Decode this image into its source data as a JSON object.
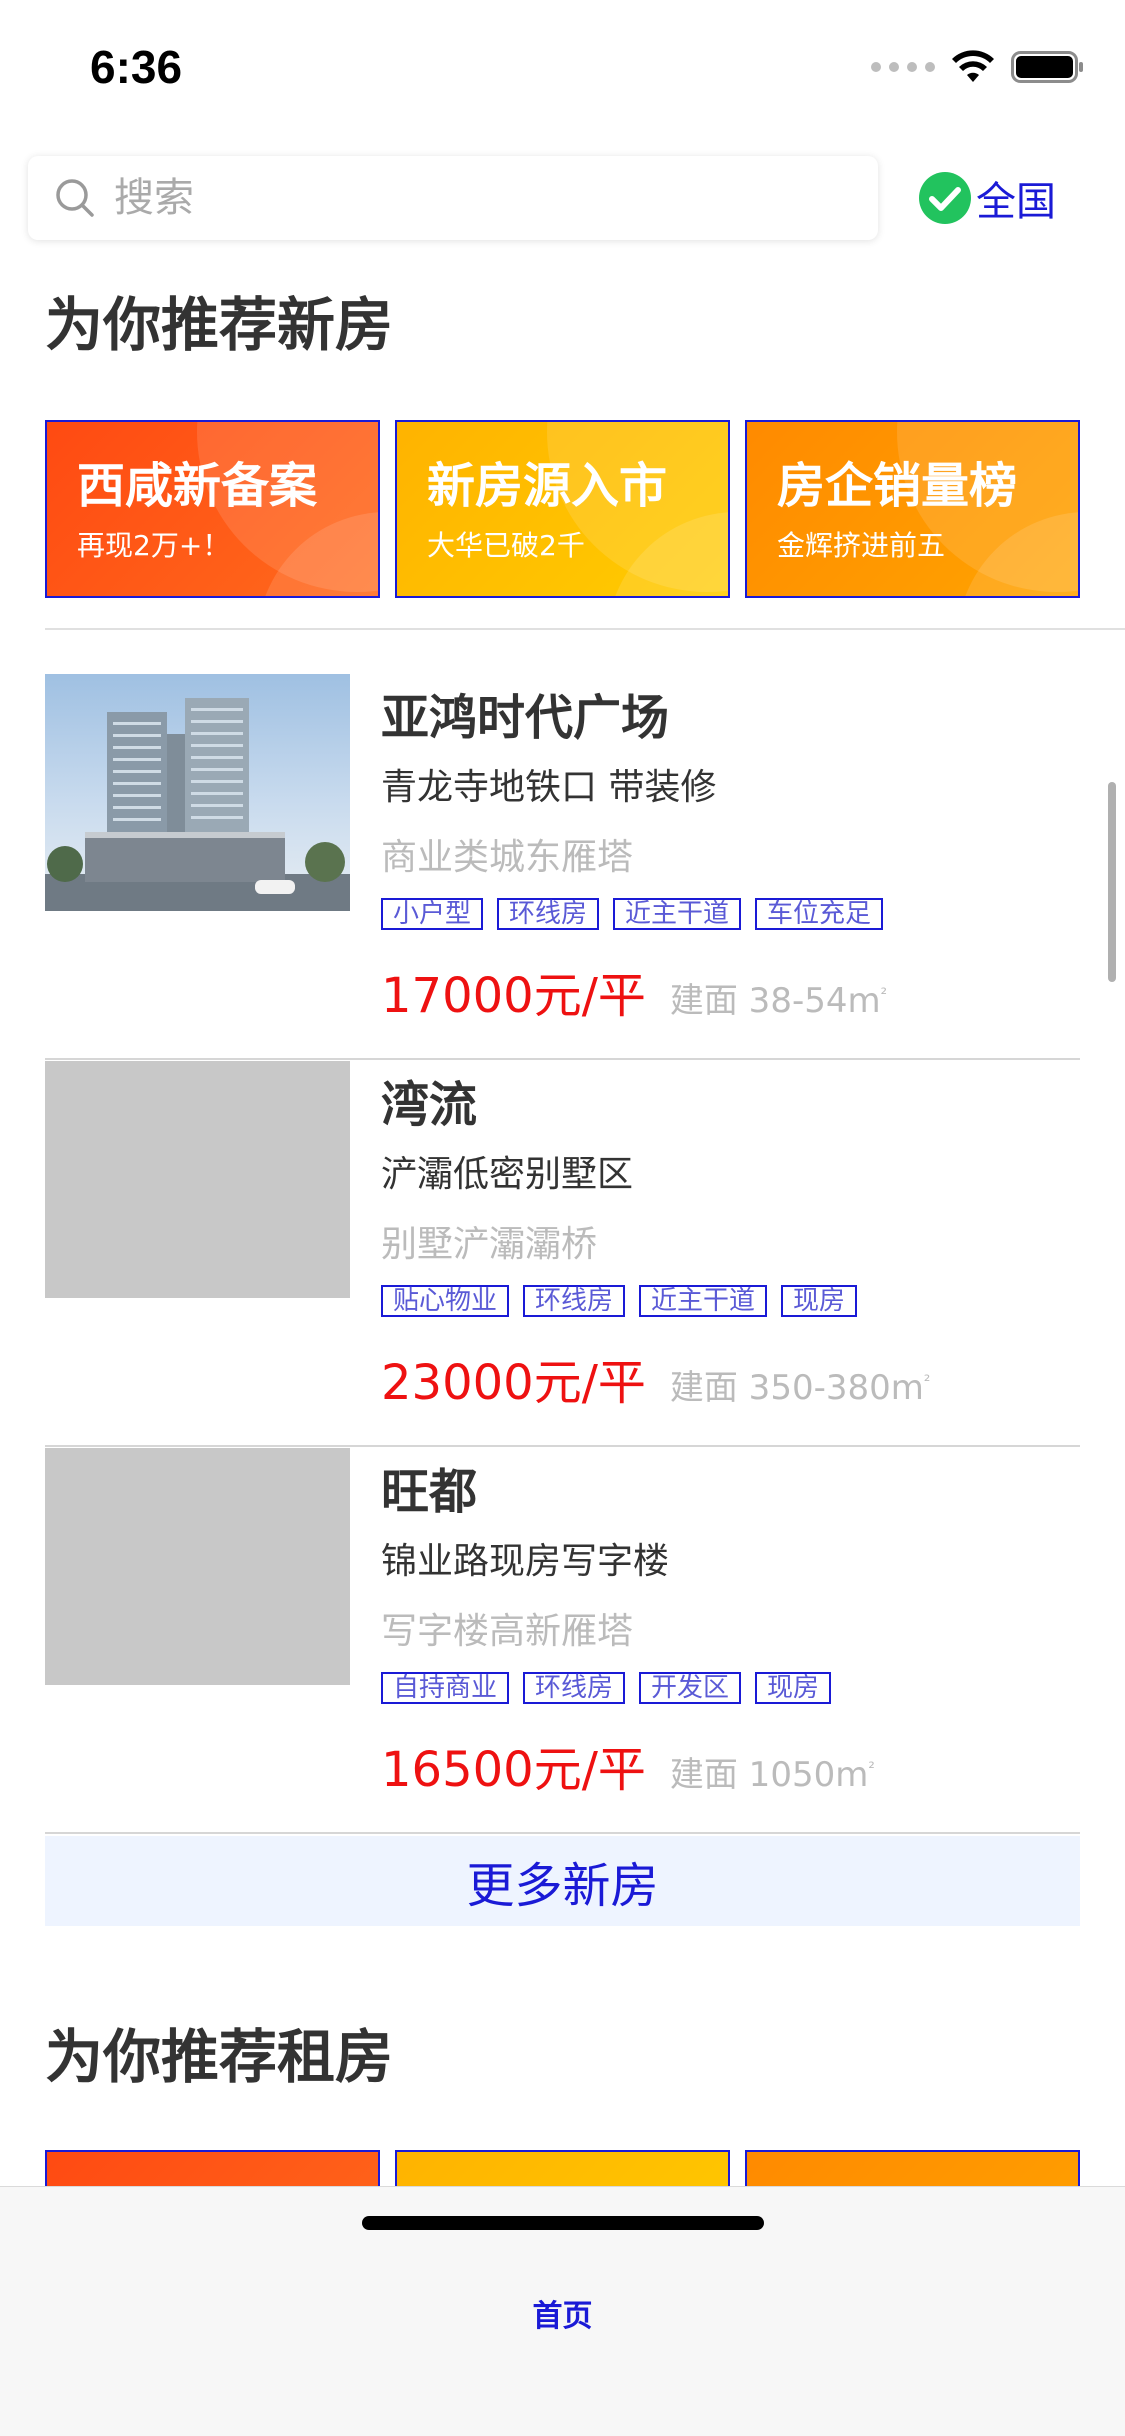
{
  "status_bar": {
    "time": "6:36"
  },
  "search": {
    "placeholder": "搜索"
  },
  "region": {
    "label": "全国",
    "icon": "check-circle-icon",
    "icon_color": "#22c35e"
  },
  "new_home_section": {
    "title": "为你推荐新房",
    "promos": [
      {
        "title": "西咸新备案",
        "subtitle": "再现2万+！",
        "color": "#ff5a14"
      },
      {
        "title": "新房源入市",
        "subtitle": "大华已破2千",
        "color": "#ffc200"
      },
      {
        "title": "房企销量榜",
        "subtitle": "金辉挤进前五",
        "color": "#ff9a00"
      }
    ],
    "listings": [
      {
        "name": "亚鸿时代广场",
        "description": "青龙寺地铁口 带装修",
        "category": "商业类城东雁塔",
        "tags": [
          "小户型",
          "环线房",
          "近主干道",
          "车位充足"
        ],
        "price": "17000元/平",
        "area": "建面 38-54m",
        "area_unit": "²"
      },
      {
        "name": "湾流",
        "description": "浐灞低密别墅区",
        "category": "别墅浐灞灞桥",
        "tags": [
          "贴心物业",
          "环线房",
          "近主干道",
          "现房"
        ],
        "price": "23000元/平",
        "area": "建面 350-380m",
        "area_unit": "²"
      },
      {
        "name": "旺都",
        "description": "锦业路现房写字楼",
        "category": "写字楼高新雁塔",
        "tags": [
          "自持商业",
          "环线房",
          "开发区",
          "现房"
        ],
        "price": "16500元/平",
        "area": "建面 1050m",
        "area_unit": "²"
      }
    ],
    "more_label": "更多新房"
  },
  "rent_section": {
    "title": "为你推荐租房"
  },
  "tab_bar": {
    "home_label": "首页"
  },
  "colors": {
    "accent": "#1a1ad6",
    "price": "#ee1111",
    "muted": "#bbbbbb"
  }
}
